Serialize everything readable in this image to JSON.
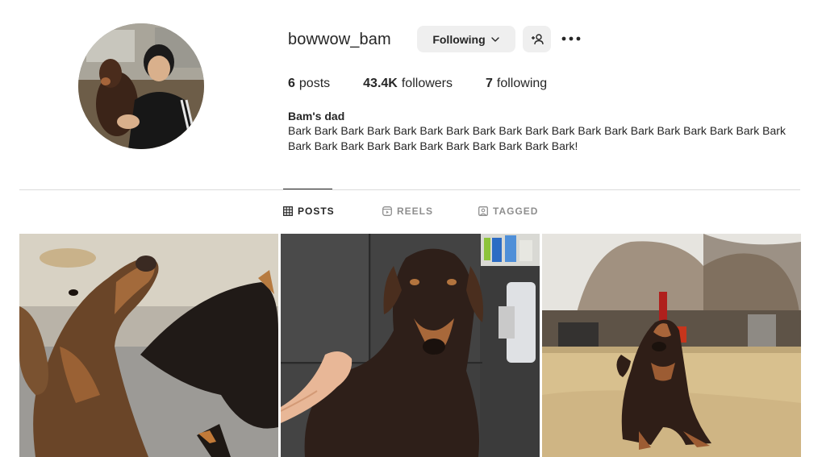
{
  "profile": {
    "username": "bowwow_bam",
    "following_button": "Following",
    "stats": {
      "posts_count": "6",
      "posts_label": "posts",
      "followers_count": "43.4K",
      "followers_label": "followers",
      "following_count": "7",
      "following_label": "following"
    },
    "bio_name": "Bam's dad",
    "bio_text": "Bark Bark Bark Bark Bark Bark Bark Bark Bark Bark Bark Bark Bark Bark Bark Bark Bark Bark Bark Bark Bark Bark Bark Bark Bark Bark Bark Bark Bark Bark!"
  },
  "tabs": [
    {
      "label": "POSTS",
      "icon": "grid-icon",
      "active": true
    },
    {
      "label": "REELS",
      "icon": "reels-icon",
      "active": false
    },
    {
      "label": "TAGGED",
      "icon": "tagged-icon",
      "active": false
    }
  ],
  "posts": [
    {
      "alt": "doberman puppy looking up"
    },
    {
      "alt": "doberman getting a bath"
    },
    {
      "alt": "doberman sitting in yard"
    }
  ],
  "colors": {
    "text": "#262626",
    "secondary": "#8e8e8e",
    "button_bg": "#efefef",
    "divider": "#dbdbdb"
  }
}
